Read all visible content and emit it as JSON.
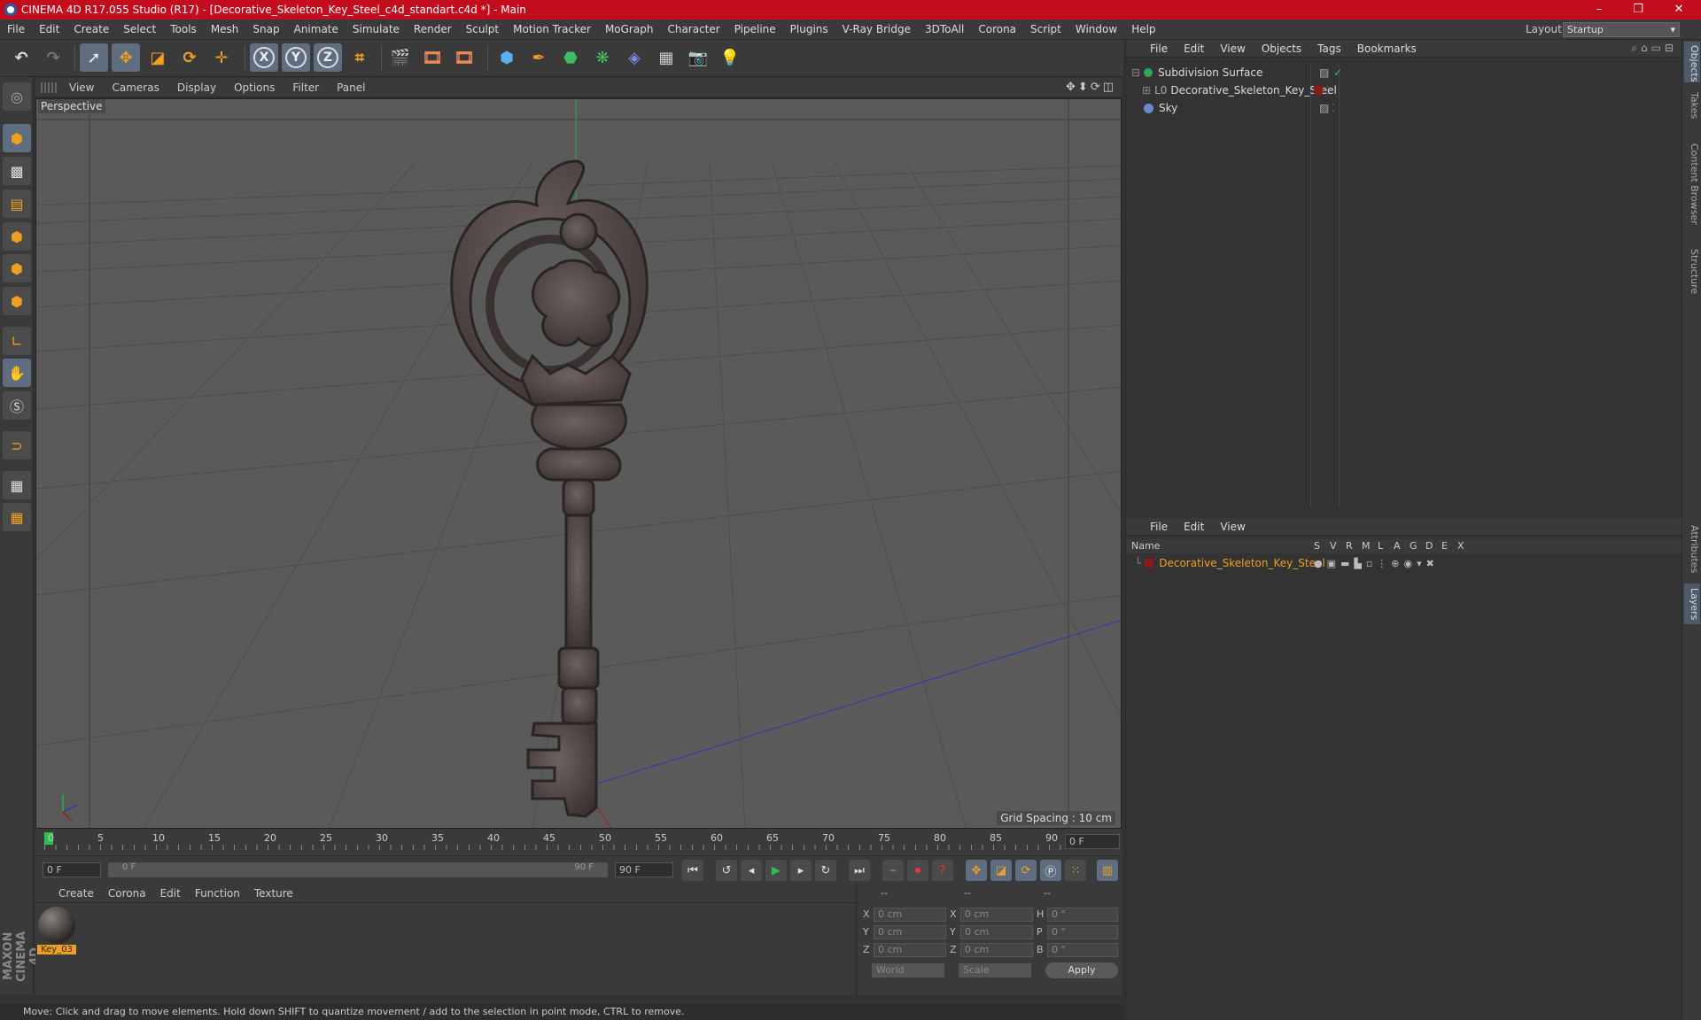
{
  "window": {
    "title": "CINEMA 4D R17.055 Studio (R17) - [Decorative_Skeleton_Key_Steel_c4d_standart.c4d *] - Main",
    "minimize": "–",
    "maximize": "❐",
    "close": "✕"
  },
  "menubar": {
    "items": [
      "File",
      "Edit",
      "Create",
      "Select",
      "Tools",
      "Mesh",
      "Snap",
      "Animate",
      "Simulate",
      "Render",
      "Sculpt",
      "Motion Tracker",
      "MoGraph",
      "Character",
      "Pipeline",
      "Plugins",
      "V-Ray Bridge",
      "3DToAll",
      "Corona",
      "Script",
      "Window",
      "Help"
    ],
    "layout_label": "Layout:",
    "layout_value": "Startup"
  },
  "toolbar": {
    "x_label": "X",
    "y_label": "Y",
    "z_label": "Z"
  },
  "viewport": {
    "menu": [
      "View",
      "Cameras",
      "Display",
      "Options",
      "Filter",
      "Panel"
    ],
    "camera_label": "Perspective",
    "grid_spacing": "Grid Spacing : 10 cm"
  },
  "timeline": {
    "ticks": [
      "0",
      "5",
      "10",
      "15",
      "20",
      "25",
      "30",
      "35",
      "40",
      "45",
      "50",
      "55",
      "60",
      "65",
      "70",
      "75",
      "80",
      "85",
      "90"
    ],
    "current_frame": "0 F",
    "start_field": "0 F",
    "slider_start": "0 F",
    "slider_end": "90 F",
    "end_field": "90 F"
  },
  "materials": {
    "menu": [
      "Create",
      "Corona",
      "Edit",
      "Function",
      "Texture"
    ],
    "items": [
      {
        "name": "Key_03"
      }
    ]
  },
  "coordinates": {
    "headers": [
      "--",
      "--",
      "--"
    ],
    "rows": [
      {
        "a": "X",
        "av": "0 cm",
        "b": "X",
        "bv": "0 cm",
        "c": "H",
        "cv": "0 °"
      },
      {
        "a": "Y",
        "av": "0 cm",
        "b": "Y",
        "bv": "0 cm",
        "c": "P",
        "cv": "0 °"
      },
      {
        "a": "Z",
        "av": "0 cm",
        "b": "Z",
        "bv": "0 cm",
        "c": "B",
        "cv": "0 °"
      }
    ],
    "world": "World",
    "scale": "Scale",
    "apply": "Apply"
  },
  "statusbar": {
    "text": "Move: Click and drag to move elements. Hold down SHIFT to quantize movement / add to the selection in point mode, CTRL to remove."
  },
  "objects": {
    "menu": [
      "File",
      "Edit",
      "View",
      "Objects",
      "Tags",
      "Bookmarks"
    ],
    "rows": [
      {
        "name": "Subdivision Surface",
        "color": "#2fa84f"
      },
      {
        "name": "Decorative_Skeleton_Key_Steel",
        "color": "#9a9a9a"
      },
      {
        "name": "Sky",
        "color": "#6a8ad0"
      }
    ]
  },
  "layers": {
    "menu": [
      "File",
      "Edit",
      "View"
    ],
    "name_header": "Name",
    "columns": [
      "S",
      "V",
      "R",
      "M",
      "L",
      "A",
      "G",
      "D",
      "E",
      "X"
    ],
    "rows": [
      {
        "name": "Decorative_Skeleton_Key_Steel",
        "color": "#8b1a1a"
      }
    ]
  },
  "side_tabs": [
    "Objects",
    "Takes",
    "Content Browser",
    "Structure",
    "Attributes",
    "Layers"
  ],
  "colors": {
    "titlebar": "#c30d1e",
    "accent_orange": "#f0a020",
    "selection_blue": "#5e6d80"
  },
  "brand": "MAXON CINEMA 4D"
}
